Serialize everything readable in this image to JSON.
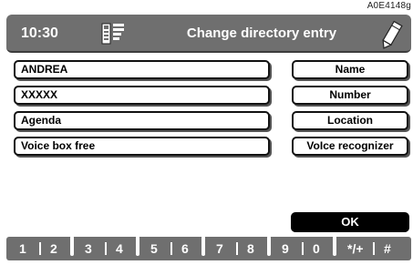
{
  "ref_code": "A0E4148g",
  "header": {
    "time": "10:30",
    "title": "Change directory entry",
    "phonebook_icon": "phonebook-icon",
    "edit_icon": "pencil-icon"
  },
  "fields": [
    {
      "value": "ANDREA"
    },
    {
      "value": "XXXXX"
    },
    {
      "value": "Agenda"
    },
    {
      "value": "Voice box free"
    }
  ],
  "actions": [
    {
      "label": "Name"
    },
    {
      "label": "Number"
    },
    {
      "label": "Location"
    },
    {
      "label": "VoIce recognizer"
    }
  ],
  "ok_label": "OK",
  "keypad": {
    "keys": [
      "1",
      "2",
      "3",
      "4",
      "5",
      "6",
      "7",
      "8",
      "9",
      "0",
      "*/+",
      "#"
    ]
  },
  "colors": {
    "bar": "#6f6f6f",
    "ok_bg": "#000000",
    "text_on_bar": "#ffffff"
  }
}
